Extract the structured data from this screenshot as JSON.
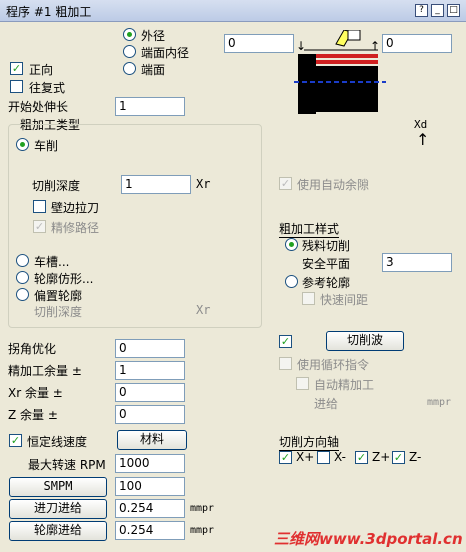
{
  "window": {
    "title": "程序 #1 粗加工",
    "help_label": "?",
    "min_label": "_",
    "max_label": "□",
    "close_label": "×"
  },
  "position": {
    "outer": "外径",
    "face_inner": "端面内径",
    "face": "端面"
  },
  "left_value": "0",
  "right_value": "0",
  "forward": "正向",
  "reciprocating": "往复式",
  "start_extension": {
    "label": "开始处伸长",
    "value": "1"
  },
  "rough_type": {
    "group_label": "粗加工类型",
    "turning": "车削",
    "cut_depth_label": "切削深度",
    "cut_depth_value": "1",
    "unit_xr": "Xr",
    "wall_pull": "壁边拉刀",
    "finish_path": "精修路径",
    "grooving": "车槽...",
    "profile_copy": "轮廓仿形...",
    "offset_profile": "偏置轮廓",
    "cut_depth2_label": "切削深度",
    "unit_xr2": "Xr"
  },
  "auto_allowance": "使用自动余隙",
  "xd_label": "Xd",
  "rough_style": {
    "heading": "粗加工样式",
    "residual": "残料切削",
    "safe_plane_label": "安全平面",
    "safe_plane_value": "3",
    "ref_profile": "参考轮廓",
    "rapid_gap": "快速间距"
  },
  "cut_wave_button": "切削波",
  "use_cycle": "使用循环指令",
  "auto_finish": "自动精加工",
  "feed_label": "进给",
  "mmpr": "mmpr",
  "corner_opt": {
    "label": "拐角优化",
    "value": "0"
  },
  "rough_allowance": {
    "label": "精加工余量 ±",
    "value": "1"
  },
  "xr_allowance": {
    "label": "Xr 余量 ±",
    "value": "0"
  },
  "z_allowance": {
    "label": "Z 余量 ±",
    "value": "0"
  },
  "css": {
    "label": "恒定线速度",
    "material_button": "材料"
  },
  "max_rpm": {
    "label": "最大转速 RPM",
    "value": "1000"
  },
  "smpm": {
    "button": "SMPM",
    "value": "100"
  },
  "plunge_feed": {
    "button": "进刀进给",
    "value": "0.254",
    "unit": "mmpr"
  },
  "profile_feed": {
    "button": "轮廓进给",
    "value": "0.254",
    "unit": "mmpr"
  },
  "cut_axis": {
    "heading": "切削方向轴",
    "xplus": "X+",
    "xminus": "X-",
    "zplus": "Z+",
    "zminus": "Z-"
  },
  "watermark": "三维网www.3dportal.cn",
  "colors": {
    "accent_green": "#21a121",
    "dash_blue": "#1a3cc8",
    "red": "#d02020"
  }
}
